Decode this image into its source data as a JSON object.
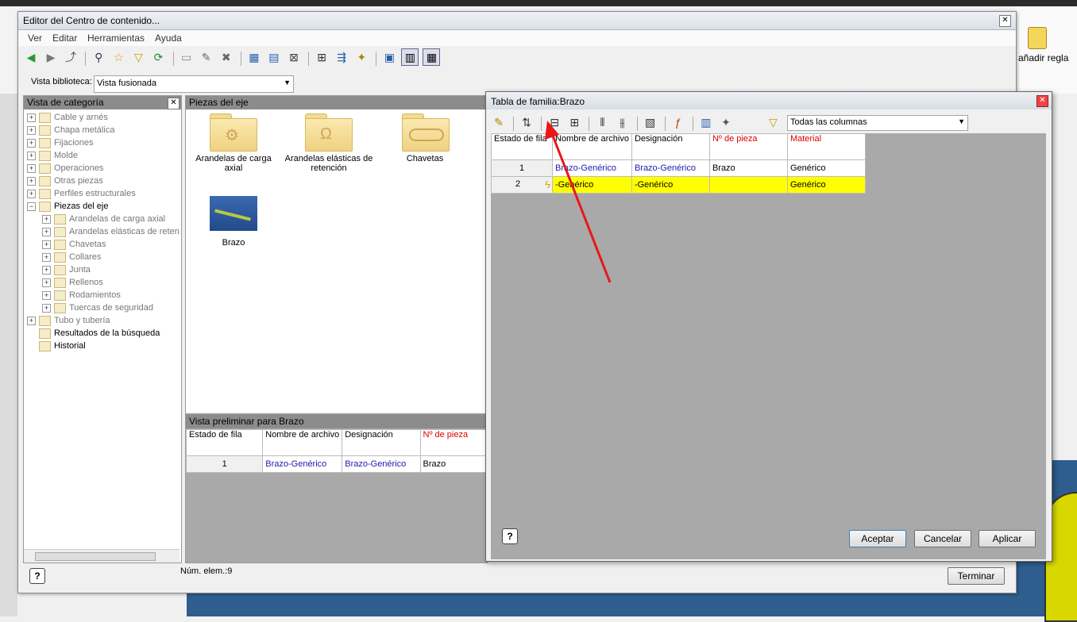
{
  "bg_app": {
    "ribbon_label": "añadir regla",
    "accent_canvas": "#2e5d8e",
    "accent_yellow": "#d8d800"
  },
  "main_window": {
    "title": "Editor del Centro de contenido...",
    "menu": [
      "Ver",
      "Editar",
      "Herramientas",
      "Ayuda"
    ],
    "library_label": "Vista biblioteca:",
    "library_value": "Vista fusionada",
    "category_panel_title": "Vista de categoría",
    "category_tree": [
      {
        "label": "Cable y arnés",
        "level": 0,
        "active": false
      },
      {
        "label": "Chapa metálica",
        "level": 0,
        "active": false
      },
      {
        "label": "Fijaciones",
        "level": 0,
        "active": false
      },
      {
        "label": "Molde",
        "level": 0,
        "active": false
      },
      {
        "label": "Operaciones",
        "level": 0,
        "active": false
      },
      {
        "label": "Otras piezas",
        "level": 0,
        "active": false
      },
      {
        "label": "Perfiles estructurales",
        "level": 0,
        "active": false
      },
      {
        "label": "Piezas del eje",
        "level": 0,
        "active": true
      },
      {
        "label": "Arandelas de carga axial",
        "level": 1,
        "active": false
      },
      {
        "label": "Arandelas elásticas de reten",
        "level": 1,
        "active": false
      },
      {
        "label": "Chavetas",
        "level": 1,
        "active": false
      },
      {
        "label": "Collares",
        "level": 1,
        "active": false
      },
      {
        "label": "Junta",
        "level": 1,
        "active": false
      },
      {
        "label": "Rellenos",
        "level": 1,
        "active": false
      },
      {
        "label": "Rodamientos",
        "level": 1,
        "active": false
      },
      {
        "label": "Tuercas de seguridad",
        "level": 1,
        "active": false
      },
      {
        "label": "Tubo y tubería",
        "level": 0,
        "active": false
      },
      {
        "label": "Resultados de la búsqueda",
        "level": 0,
        "active": true
      },
      {
        "label": "Historial",
        "level": 0,
        "active": true
      }
    ],
    "items_panel_title": "Piezas del eje",
    "items": [
      {
        "label_line1": "Arandelas de carga",
        "label_line2": "axial"
      },
      {
        "label_line1": "Arandelas elásticas de",
        "label_line2": "retención"
      },
      {
        "label_line1": "Chavetas",
        "label_line2": ""
      },
      {
        "label_line1": "Brazo",
        "label_line2": ""
      }
    ],
    "preview_title": "Vista preliminar para Brazo",
    "preview_headers": [
      "Estado de fila",
      "Nombre de archivo",
      "Designación",
      "Nº de pieza"
    ],
    "preview_row": [
      "1",
      "Brazo-Genérico",
      "Brazo-Genérico",
      "Brazo"
    ],
    "item_count": "Núm. elem.:9",
    "help_label": "?",
    "finish_button": "Terminar"
  },
  "family_dialog": {
    "title": "Tabla de familia:Brazo",
    "filter_value": "Todas las columnas",
    "headers": [
      "Estado de fila",
      "Nombre de archivo",
      "Designación",
      "Nº de pieza",
      "Material"
    ],
    "rows": [
      {
        "n": "1",
        "file": "Brazo-Genérico",
        "designation": "Brazo-Genérico",
        "part": "Brazo",
        "material": "Genérico",
        "highlight": false
      },
      {
        "n": "2",
        "file": "-Genérico",
        "designation": "-Genérico",
        "part": "",
        "material": "Genérico",
        "highlight": true
      }
    ],
    "help_label": "?",
    "buttons": {
      "accept": "Aceptar",
      "cancel": "Cancelar",
      "apply": "Aplicar"
    },
    "highlight_color": "#ffff00"
  }
}
